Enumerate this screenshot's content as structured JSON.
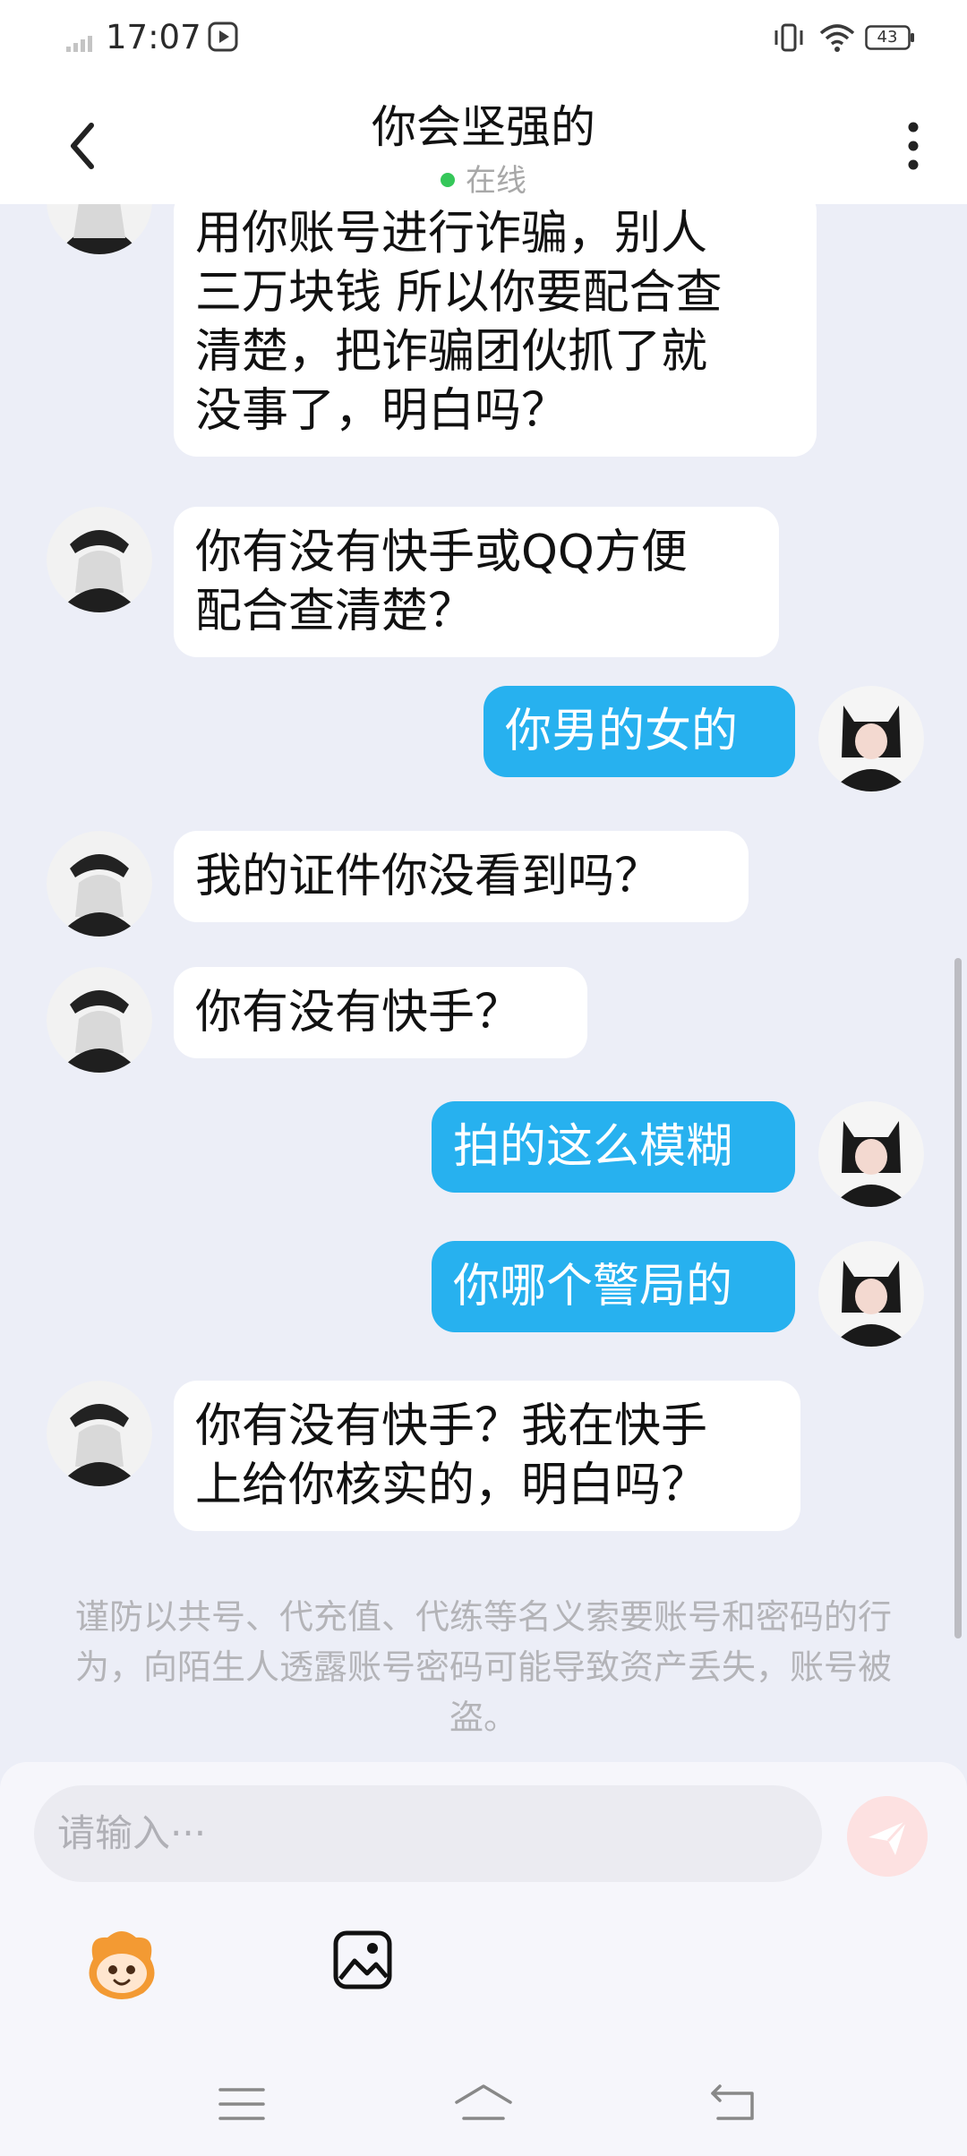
{
  "status_bar": {
    "time": "17:07",
    "battery": "43"
  },
  "header": {
    "title": "你会坚强的",
    "status": "在线"
  },
  "messages": [
    {
      "side": "in",
      "text": "用你账号进行诈骗，别人\n三万块钱 所以你要配合查\n清楚，把诈骗团伙抓了就\n没事了，明白吗？"
    },
    {
      "side": "in",
      "text": "你有没有快手或QQ方便\n配合查清楚？"
    },
    {
      "side": "out",
      "text": "你男的女的"
    },
    {
      "side": "in",
      "text": "我的证件你没看到吗？"
    },
    {
      "side": "in",
      "text": "你有没有快手？"
    },
    {
      "side": "out",
      "text": "拍的这么模糊"
    },
    {
      "side": "out",
      "text": "你哪个警局的"
    },
    {
      "side": "in",
      "text": "你有没有快手？我在快手\n上给你核实的，明白吗？"
    }
  ],
  "notice": "谨防以共号、代充值、代练等名义索要账号和密码的行为，向陌生人透露账号密码可能导致资产丢失，账号被盗。",
  "input": {
    "placeholder": "请输入···"
  },
  "colors": {
    "outgoing_bubble": "#27b1ef",
    "incoming_bubble": "#ffffff",
    "online_dot": "#35c759",
    "background": "#eceef7"
  },
  "icons": {
    "back": "chevron-left-icon",
    "more": "more-vertical-icon",
    "send": "send-icon",
    "emoji": "emoji-mascot-icon",
    "image": "image-icon",
    "nav_menu": "menu-icon",
    "nav_home": "home-icon",
    "nav_back": "back-arrow-icon"
  }
}
